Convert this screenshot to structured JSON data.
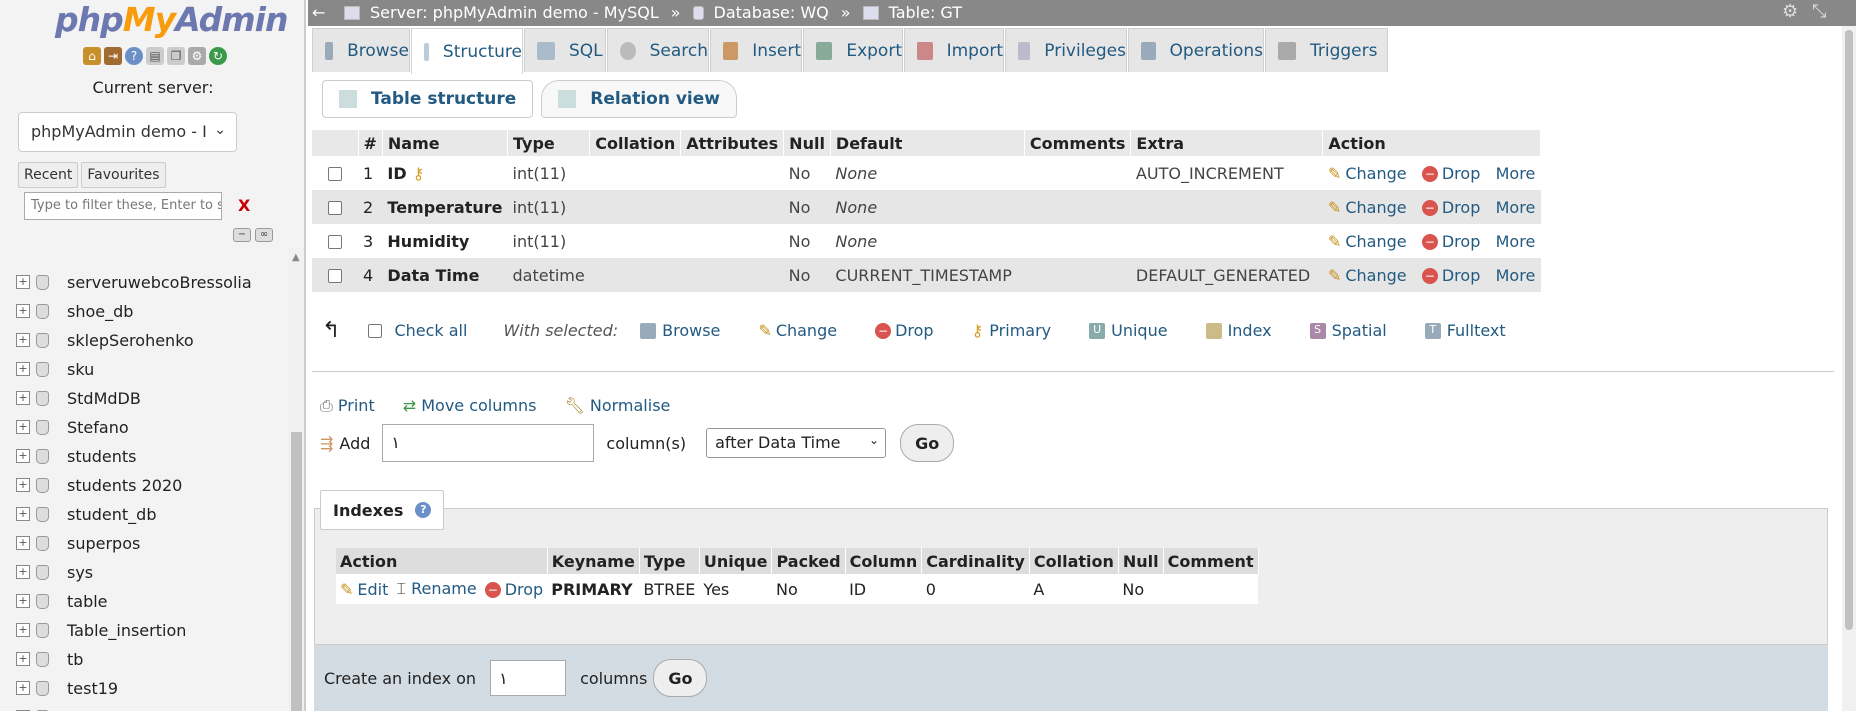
{
  "sidebar": {
    "logo_a": "php",
    "logo_b": "My",
    "logo_c": "Admin",
    "current_server_label": "Current server:",
    "server_select": "phpMyAdmin demo - I",
    "recent": "Recent",
    "favourites": "Favourites",
    "filter_placeholder": "Type to filter these, Enter to search",
    "filter_clear": "X",
    "databases": [
      "serveruwebcoBressolia",
      "shoe_db",
      "sklepSerohenko",
      "sku",
      "StdMdDB",
      "Stefano",
      "students",
      "students 2020",
      "student_db",
      "superpos",
      "sys",
      "table",
      "Table_insertion",
      "tb",
      "test19",
      "teste_teste"
    ]
  },
  "breadcrumb": {
    "server": "Server: phpMyAdmin demo - MySQL",
    "sep": "»",
    "database": "Database: WQ",
    "table": "Table: GT"
  },
  "tabs": [
    "Browse",
    "Structure",
    "SQL",
    "Search",
    "Insert",
    "Export",
    "Import",
    "Privileges",
    "Operations",
    "Triggers"
  ],
  "subtabs": [
    "Table structure",
    "Relation view"
  ],
  "structure": {
    "headers": [
      "#",
      "Name",
      "Type",
      "Collation",
      "Attributes",
      "Null",
      "Default",
      "Comments",
      "Extra",
      "Action"
    ],
    "rows": [
      {
        "num": "1",
        "name": "ID",
        "type": "int(11)",
        "collation": "",
        "attributes": "",
        "null": "No",
        "default": "None",
        "comments": "",
        "extra": "AUTO_INCREMENT"
      },
      {
        "num": "2",
        "name": "Temperature",
        "type": "int(11)",
        "collation": "",
        "attributes": "",
        "null": "No",
        "default": "None",
        "comments": "",
        "extra": ""
      },
      {
        "num": "3",
        "name": "Humidity",
        "type": "int(11)",
        "collation": "",
        "attributes": "",
        "null": "No",
        "default": "None",
        "comments": "",
        "extra": ""
      },
      {
        "num": "4",
        "name": "Data Time",
        "type": "datetime",
        "collation": "",
        "attributes": "",
        "null": "No",
        "default": "CURRENT_TIMESTAMP",
        "comments": "",
        "extra": "DEFAULT_GENERATED"
      }
    ],
    "action_change": "Change",
    "action_drop": "Drop",
    "action_more": "More"
  },
  "bulk": {
    "check_all": "Check all",
    "with_selected": "With selected:",
    "actions": [
      "Browse",
      "Change",
      "Drop",
      "Primary",
      "Unique",
      "Index",
      "Spatial",
      "Fulltext"
    ]
  },
  "tools": {
    "print": "Print",
    "move_columns": "Move columns",
    "normalise": "Normalise"
  },
  "add": {
    "label": "Add",
    "value": "١",
    "columns_label": "column(s)",
    "position": "after Data Time",
    "go": "Go"
  },
  "indexes": {
    "legend": "Indexes",
    "headers": [
      "Action",
      "Keyname",
      "Type",
      "Unique",
      "Packed",
      "Column",
      "Cardinality",
      "Collation",
      "Null",
      "Comment"
    ],
    "row": {
      "edit": "Edit",
      "rename": "Rename",
      "drop": "Drop",
      "keyname": "PRIMARY",
      "type": "BTREE",
      "unique": "Yes",
      "packed": "No",
      "column": "ID",
      "cardinality": "0",
      "collation": "A",
      "null": "No",
      "comment": ""
    }
  },
  "create_index": {
    "label": "Create an index on",
    "value": "١",
    "columns_label": "columns",
    "go": "Go"
  },
  "colors": {
    "accent": "#235a81",
    "topbar": "#888888",
    "drop": "#d9534f"
  }
}
